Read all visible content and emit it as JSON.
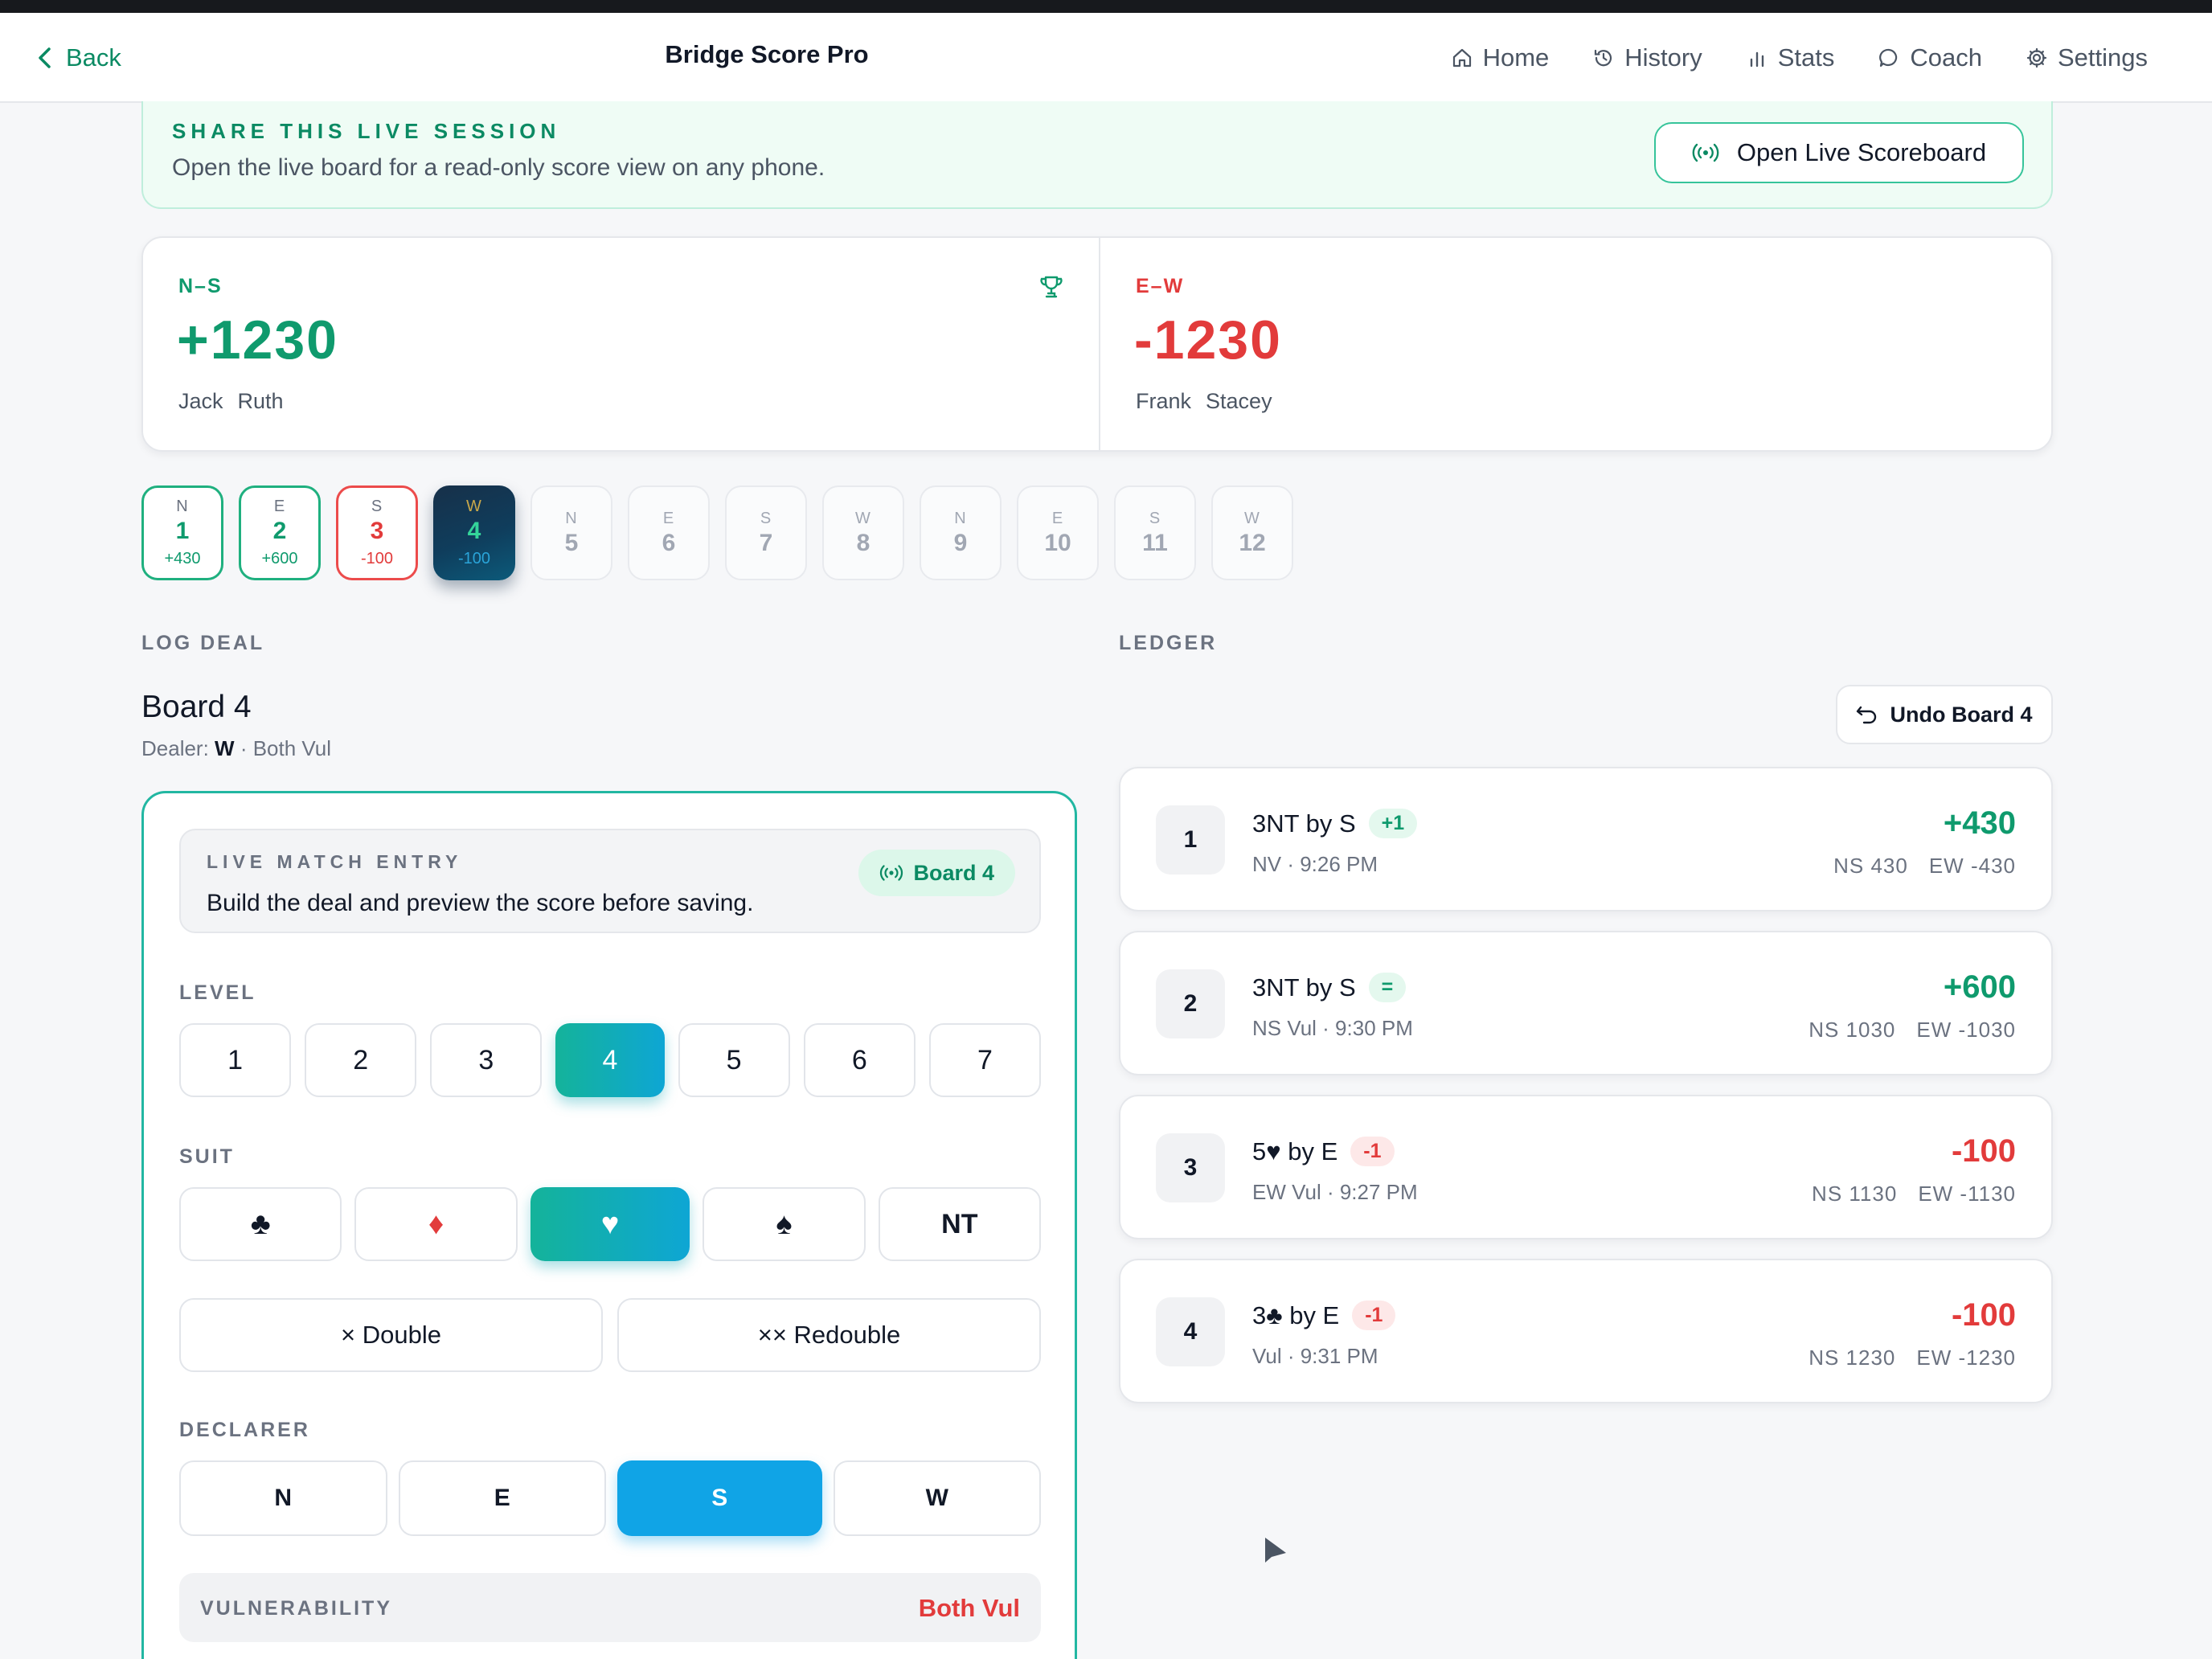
{
  "nav": {
    "back": "Back",
    "title": "Bridge Score Pro",
    "links": [
      {
        "label": "Home",
        "icon": "home-icon"
      },
      {
        "label": "History",
        "icon": "history-icon"
      },
      {
        "label": "Stats",
        "icon": "bar-chart-icon"
      },
      {
        "label": "Coach",
        "icon": "chat-bubble-icon"
      },
      {
        "label": "Settings",
        "icon": "gear-icon"
      }
    ]
  },
  "share": {
    "kicker": "SHARE THIS LIVE SESSION",
    "desc": "Open the live board for a read-only score view on any phone.",
    "button": "Open Live Scoreboard"
  },
  "score": {
    "ns": {
      "label": "N–S",
      "total": "+1230",
      "players": [
        "Jack",
        "Ruth"
      ]
    },
    "ew": {
      "label": "E–W",
      "total": "-1230",
      "players": [
        "Frank",
        "Stacey"
      ]
    }
  },
  "boards": [
    {
      "dir": "N",
      "num": "1",
      "delta": "+430",
      "state": "done-green"
    },
    {
      "dir": "E",
      "num": "2",
      "delta": "+600",
      "state": "done-green"
    },
    {
      "dir": "S",
      "num": "3",
      "delta": "-100",
      "state": "done-red"
    },
    {
      "dir": "W",
      "num": "4",
      "delta": "-100",
      "state": "active"
    },
    {
      "dir": "N",
      "num": "5",
      "delta": "",
      "state": "empty"
    },
    {
      "dir": "E",
      "num": "6",
      "delta": "",
      "state": "empty"
    },
    {
      "dir": "S",
      "num": "7",
      "delta": "",
      "state": "empty"
    },
    {
      "dir": "W",
      "num": "8",
      "delta": "",
      "state": "empty"
    },
    {
      "dir": "N",
      "num": "9",
      "delta": "",
      "state": "empty"
    },
    {
      "dir": "E",
      "num": "10",
      "delta": "",
      "state": "empty"
    },
    {
      "dir": "S",
      "num": "11",
      "delta": "",
      "state": "empty"
    },
    {
      "dir": "W",
      "num": "12",
      "delta": "",
      "state": "empty"
    }
  ],
  "log": {
    "section": "LOG DEAL",
    "board_title": "Board 4",
    "dealer_prefix": "Dealer: ",
    "dealer": "W",
    "vul_suffix": " · Both Vul",
    "entry_kicker": "LIVE MATCH ENTRY",
    "entry_desc": "Build the deal and preview the score before saving.",
    "entry_badge": "Board 4",
    "level_label": "LEVEL",
    "levels": [
      "1",
      "2",
      "3",
      "4",
      "5",
      "6",
      "7"
    ],
    "level_selected": "4",
    "suit_label": "SUIT",
    "suits": [
      {
        "glyph": "♣",
        "color": "#111827"
      },
      {
        "glyph": "♦",
        "color": "#e23b3b"
      },
      {
        "glyph": "♥",
        "color": "#ffffff"
      },
      {
        "glyph": "♠",
        "color": "#111827"
      },
      {
        "glyph": "NT",
        "color": "#111827"
      }
    ],
    "suit_selected_index": 2,
    "double": "× Double",
    "redouble": "×× Redouble",
    "declarer_label": "DECLARER",
    "declarers": [
      "N",
      "E",
      "S",
      "W"
    ],
    "declarer_selected": "S",
    "vul_label": "VULNERABILITY",
    "vul_value": "Both Vul"
  },
  "ledger": {
    "section": "LEDGER",
    "undo": "Undo Board 4",
    "rows": [
      {
        "num": "1",
        "contract": "3NT by S",
        "result": "+1",
        "result_kind": "pos",
        "meta": "NV · 9:26 PM",
        "score": "+430",
        "score_kind": "pos",
        "ns": "NS 430",
        "ew": "EW -430"
      },
      {
        "num": "2",
        "contract": "3NT by S",
        "result": "=",
        "result_kind": "pos",
        "meta": "NS Vul · 9:30 PM",
        "score": "+600",
        "score_kind": "pos",
        "ns": "NS 1030",
        "ew": "EW -1030"
      },
      {
        "num": "3",
        "contract": "5♥ by E",
        "result": "-1",
        "result_kind": "neg",
        "meta": "EW Vul · 9:27 PM",
        "score": "-100",
        "score_kind": "neg",
        "ns": "NS 1130",
        "ew": "EW -1130"
      },
      {
        "num": "4",
        "contract": "3♣ by E",
        "result": "-1",
        "result_kind": "neg",
        "meta": "Vul · 9:31 PM",
        "score": "-100",
        "score_kind": "neg",
        "ns": "NS 1230",
        "ew": "EW -1230"
      }
    ]
  },
  "colors": {
    "accent": "#0f9a6d",
    "negative": "#e23b3b",
    "selected_blue": "#10a4e6"
  }
}
